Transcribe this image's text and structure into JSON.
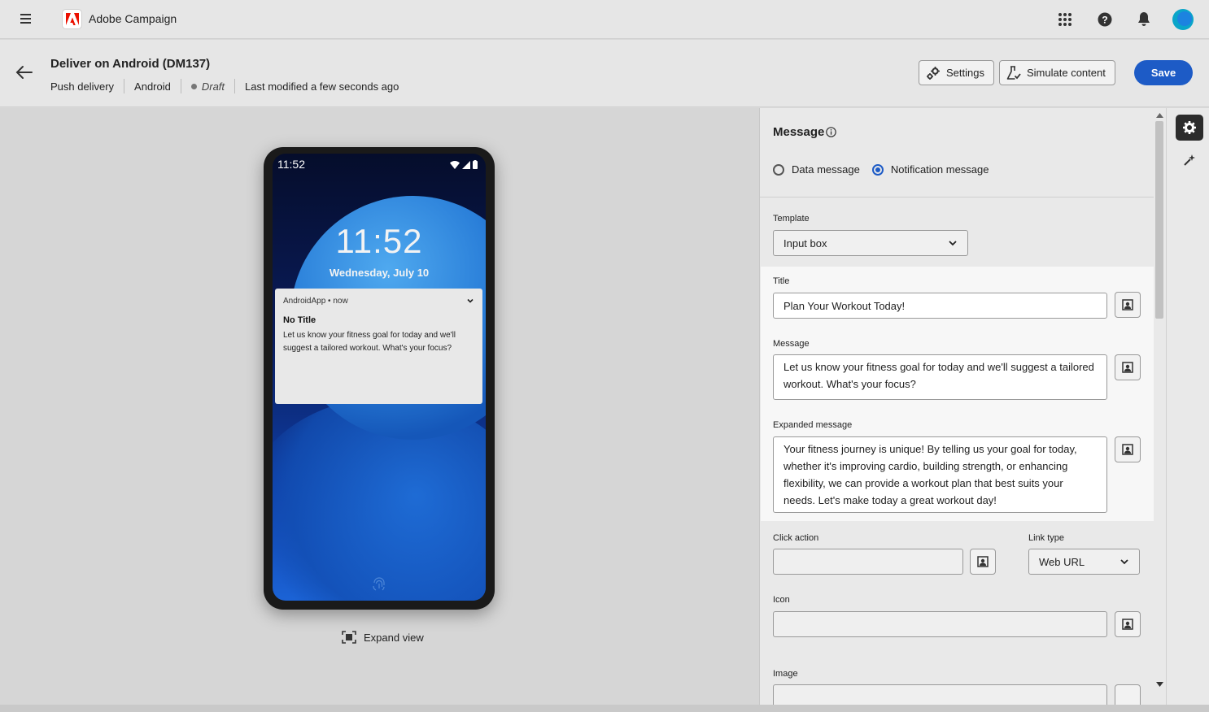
{
  "app": {
    "title": "Adobe Campaign"
  },
  "header": {
    "title": "Deliver on Android (DM137)",
    "meta": [
      "Push delivery",
      "Android",
      "Draft",
      "Last modified a few seconds ago"
    ],
    "settings_label": "Settings",
    "simulate_label": "Simulate content",
    "save_label": "Save"
  },
  "preview": {
    "status_time": "11:52",
    "lock_time": "11:52",
    "lock_date": "Wednesday, July 10",
    "notification": {
      "app_line": "AndroidApp • now",
      "title": "No Title",
      "body": "Let us know your fitness goal for today and we'll suggest a tailored workout. What's your focus?"
    },
    "expand_label": "Expand view"
  },
  "panel": {
    "heading": "Message",
    "radio_data": "Data message",
    "radio_notification": "Notification message",
    "template_label": "Template",
    "template_value": "Input box",
    "title_label": "Title",
    "title_value": "Plan Your Workout Today!",
    "message_label": "Message",
    "message_value": "Let us know your fitness goal for today and we'll suggest a tailored workout. What's your focus?",
    "expanded_label": "Expanded message",
    "expanded_value": "Your fitness journey is unique! By telling us your goal for today, whether it's improving cardio, building strength, or enhancing flexibility, we can provide a workout plan that best suits your needs. Let's make today a great workout day!",
    "click_action_label": "Click action",
    "click_action_value": "",
    "link_type_label": "Link type",
    "link_type_value": "Web URL",
    "icon_label": "Icon",
    "icon_value": "",
    "image_label": "Image"
  },
  "colors": {
    "accent": "#1d5bc6",
    "brand_red": "#eb1000"
  }
}
